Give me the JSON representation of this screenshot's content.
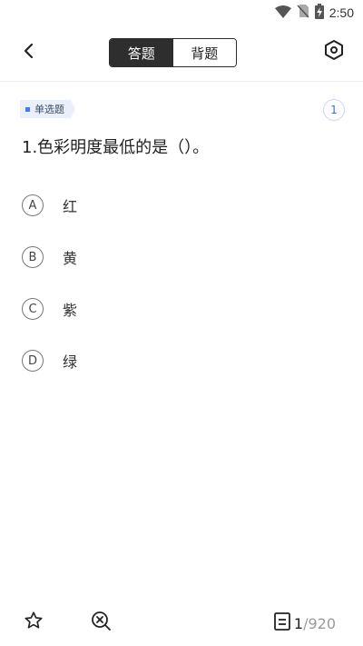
{
  "status_bar": {
    "time": "2:50"
  },
  "header": {
    "mode_tabs": [
      {
        "label": "答题",
        "active": true
      },
      {
        "label": "背题",
        "active": false
      }
    ]
  },
  "question": {
    "type_label": "单选题",
    "number_badge": "1",
    "text": "1.色彩明度最低的是（）。",
    "options": [
      {
        "letter": "A",
        "text": "红"
      },
      {
        "letter": "B",
        "text": "黄"
      },
      {
        "letter": "C",
        "text": "紫"
      },
      {
        "letter": "D",
        "text": "绿"
      }
    ]
  },
  "footer": {
    "current": "1",
    "total": "/920"
  },
  "icons": {
    "back": "chevron-left-icon",
    "settings": "hexagon-settings-icon",
    "favorite": "star-icon",
    "remove": "zoom-out-x-icon",
    "answer_sheet": "answer-sheet-icon"
  },
  "colors": {
    "accent": "#3a7bf0",
    "active_tab_bg": "#2e2e2e"
  }
}
